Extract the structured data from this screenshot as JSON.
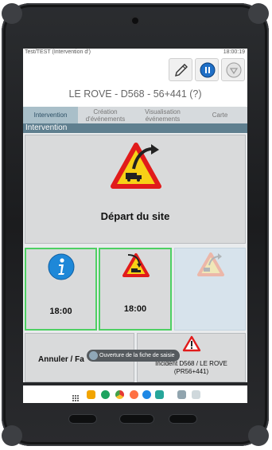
{
  "status_bar": {
    "left_text": "Test/TEST (Intervention d')",
    "time": "18:00:19"
  },
  "toolbar": {
    "edit_icon": "pencil-icon",
    "pause_icon": "pause-icon",
    "stop_icon": "shield-icon"
  },
  "header": {
    "title": "LE ROVE - D568 - 56+441 (?)"
  },
  "tabs": [
    {
      "label": "Intervention"
    },
    {
      "label": "Création d'événements"
    },
    {
      "label": "Visualisation événements"
    },
    {
      "label": "Carte"
    }
  ],
  "section_title": "Intervention",
  "tiles": {
    "depart": {
      "label": "Départ du site",
      "icon": "depart-warning-icon"
    },
    "info": {
      "time": "18:00",
      "icon": "info-icon"
    },
    "arrivee": {
      "time": "18:00",
      "icon": "arrivee-warning-icon"
    },
    "disabled_icon": "depart-warning-icon-disabled",
    "annuler": {
      "label": "Annuler / Fa"
    },
    "incident": {
      "label": "Incident D568 / LE ROVE",
      "sub": "(PR56+441)",
      "icon": "warning-icon"
    }
  },
  "toast": {
    "text": "Ouverture de la fiche de saisie"
  },
  "colors": {
    "accent_tab": "#a9bfc9",
    "section": "#5f7f8f",
    "green_border": "#4ed063",
    "warning_red": "#e11b1b",
    "warning_yellow": "#f7d117",
    "info_blue": "#1e88d8"
  }
}
